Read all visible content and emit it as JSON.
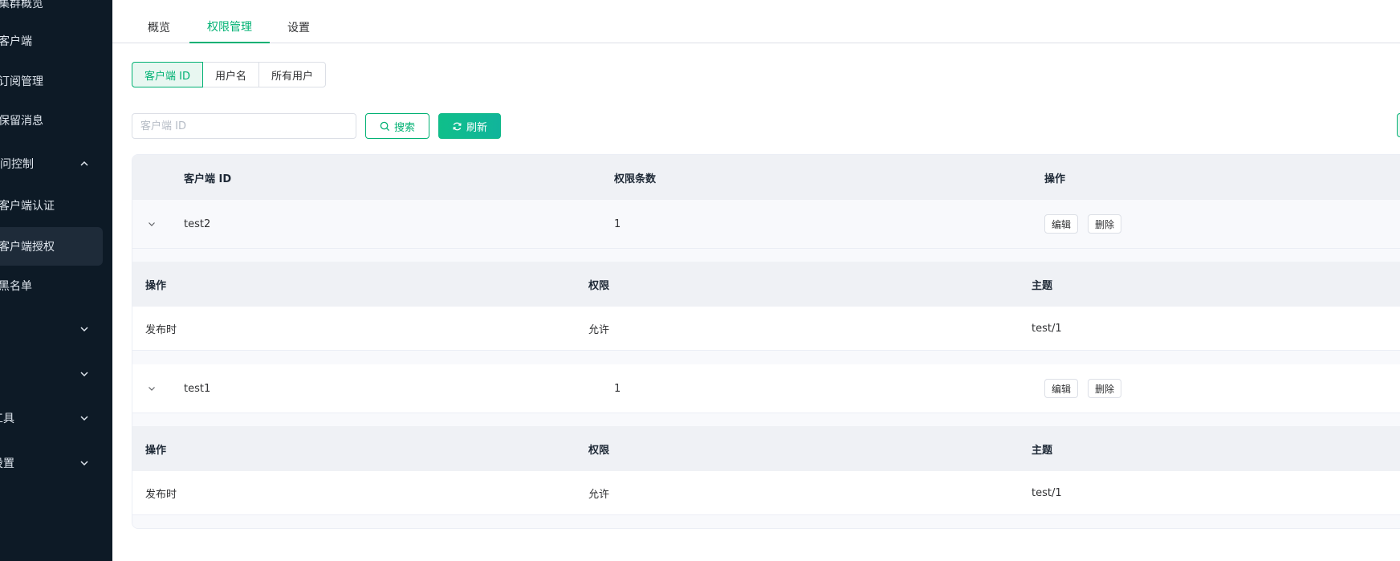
{
  "sidebar": {
    "items": [
      {
        "label": "集群概览",
        "chevron": ""
      },
      {
        "label": "客户端",
        "chevron": ""
      },
      {
        "label": "订阅管理",
        "chevron": ""
      },
      {
        "label": "保留消息",
        "chevron": ""
      },
      {
        "label": "访问控制",
        "chevron": "chevron-up-icon"
      },
      {
        "label": "客户端认证",
        "chevron": ""
      },
      {
        "label": "客户端授权",
        "chevron": "",
        "active": true
      },
      {
        "label": "黑名单",
        "chevron": ""
      },
      {
        "label": "",
        "chevron": "chevron-down-icon"
      },
      {
        "label": "",
        "chevron": "chevron-down-icon"
      },
      {
        "label": "工具",
        "chevron": "chevron-down-icon"
      },
      {
        "label": "设置",
        "chevron": "chevron-down-icon"
      }
    ]
  },
  "tabs": [
    "概览",
    "权限管理",
    "设置"
  ],
  "active_tab": "权限管理",
  "segments": [
    "客户端 ID",
    "用户名",
    "所有用户"
  ],
  "active_segment": "客户端 ID",
  "search": {
    "placeholder": "客户端 ID",
    "value": ""
  },
  "buttons": {
    "search": "搜索",
    "refresh": "刷新"
  },
  "table": {
    "headers": [
      "客户端 ID",
      "权限条数",
      "操作"
    ],
    "rows": [
      {
        "client_id": "test2",
        "count": "1",
        "edit": "编辑",
        "delete": "删除",
        "sub_headers": [
          "操作",
          "权限",
          "主题"
        ],
        "sub_rows": [
          [
            "发布时",
            "允许",
            "test/1"
          ]
        ]
      },
      {
        "client_id": "test1",
        "count": "1",
        "edit": "编辑",
        "delete": "删除",
        "sub_headers": [
          "操作",
          "权限",
          "主题"
        ],
        "sub_rows": [
          [
            "发布时",
            "允许",
            "test/1"
          ]
        ]
      }
    ]
  },
  "colors": {
    "accent": "#00b173",
    "sidebar_bg": "#0d1a26"
  }
}
